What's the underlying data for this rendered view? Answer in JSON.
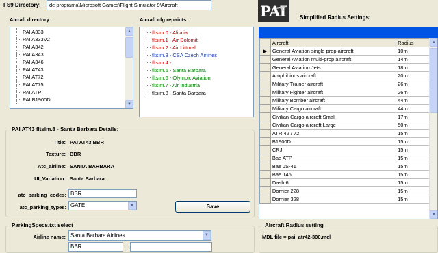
{
  "fs9_directory": {
    "label": "FS9 Directory:",
    "value": "de programa\\Microsoft Games\\Flight Simulator 9\\Aircraft"
  },
  "aircraft_directory": {
    "label": "Aicraft directory:",
    "items": [
      {
        "label": "PAI A333"
      },
      {
        "label": "PAI A333V2"
      },
      {
        "label": "PAI A342"
      },
      {
        "label": "PAI A343"
      },
      {
        "label": "PAI A346"
      },
      {
        "label": "PAI AT43"
      },
      {
        "label": "PAI AT72"
      },
      {
        "label": "PAI AT75"
      },
      {
        "label": "PAI ATP"
      },
      {
        "label": "PAI B1900D"
      }
    ]
  },
  "repaints": {
    "label": "Aicraft.cfg repaints:",
    "items": [
      {
        "label": "fltsim.0 - Alitalia",
        "color": "#c00000"
      },
      {
        "label": "fltsim.1 - Air Dolomiti",
        "color": "#c00000"
      },
      {
        "label": "fltsim.2 - Air Littoral",
        "color": "#c00000"
      },
      {
        "label": "fltsim.3 - CSA Czech Airlines",
        "color": "#1a3caa"
      },
      {
        "label": "fltsim.4 -",
        "color": "#c00000"
      },
      {
        "label": "fltsim.5 - Santa Barbara",
        "color": "#008000"
      },
      {
        "label": "fltsim.6 - Olympic Aviation",
        "color": "#008000"
      },
      {
        "label": "fltsim.7 - Air Industria",
        "color": "#008000"
      },
      {
        "label": "fltsim.8 - Santa Barbara",
        "color": "#000000"
      }
    ]
  },
  "logo": {
    "text": "PAI"
  },
  "simplified_radius": {
    "title": "Simplified Radius Settings:",
    "columns": [
      "Aircraft",
      "Radius"
    ],
    "rows": [
      {
        "aircraft": "General Aviation single prop aircraft",
        "radius": "10m"
      },
      {
        "aircraft": "General Aviation multi-prop aircraft",
        "radius": "14m"
      },
      {
        "aircraft": "General Aviation Jets",
        "radius": "18m"
      },
      {
        "aircraft": "Amphibious aircraft",
        "radius": "20m"
      },
      {
        "aircraft": "Military Trainer aircraft",
        "radius": "26m"
      },
      {
        "aircraft": "Military Fighter aircraft",
        "radius": "26m"
      },
      {
        "aircraft": "Military Bomber aircraft",
        "radius": "44m"
      },
      {
        "aircraft": "Military Cargo aircraft",
        "radius": "44m"
      },
      {
        "aircraft": "Civilian Cargo aircraft Small",
        "radius": "17m"
      },
      {
        "aircraft": "Civilian Cargo aircraft Large",
        "radius": "50m"
      },
      {
        "aircraft": "ATR 42 / 72",
        "radius": "15m"
      },
      {
        "aircraft": "B1900D",
        "radius": "15m"
      },
      {
        "aircraft": "CRJ",
        "radius": "15m"
      },
      {
        "aircraft": "Bae ATP",
        "radius": "15m"
      },
      {
        "aircraft": "Bae JS-41",
        "radius": "15m"
      },
      {
        "aircraft": "Bae 146",
        "radius": "15m"
      },
      {
        "aircraft": "Dash 6",
        "radius": "15m"
      },
      {
        "aircraft": "Dornier 228",
        "radius": "15m"
      },
      {
        "aircraft": "Dornier 328",
        "radius": "15m"
      }
    ]
  },
  "details": {
    "title": "PAI AT43   fltsim.8 - Santa Barbara   Details:",
    "fields": [
      {
        "label": "Title:",
        "value": "PAI AT43 BBR"
      },
      {
        "label": "Texture:",
        "value": "BBR"
      },
      {
        "label": "Atc_airline:",
        "value": "SANTA BARBARA"
      },
      {
        "label": "UI_Variation:",
        "value": "Santa Barbara"
      }
    ],
    "parking_codes_label": "atc_parking_codes:",
    "parking_codes_value": "BBR",
    "parking_types_label": "atc_parking_types:",
    "parking_types_value": "GATE",
    "save_label": "Save"
  },
  "parkingspecs": {
    "title": "ParkingSpecs.txt select",
    "airline_label": "Airline name:",
    "airline_value": "Santa Barbara Airlines",
    "code_value": "BBR"
  },
  "radius_setting": {
    "title": "Aircraft Radius setting",
    "mdl_file": "MDL file = pai_atr42-300.mdl"
  }
}
